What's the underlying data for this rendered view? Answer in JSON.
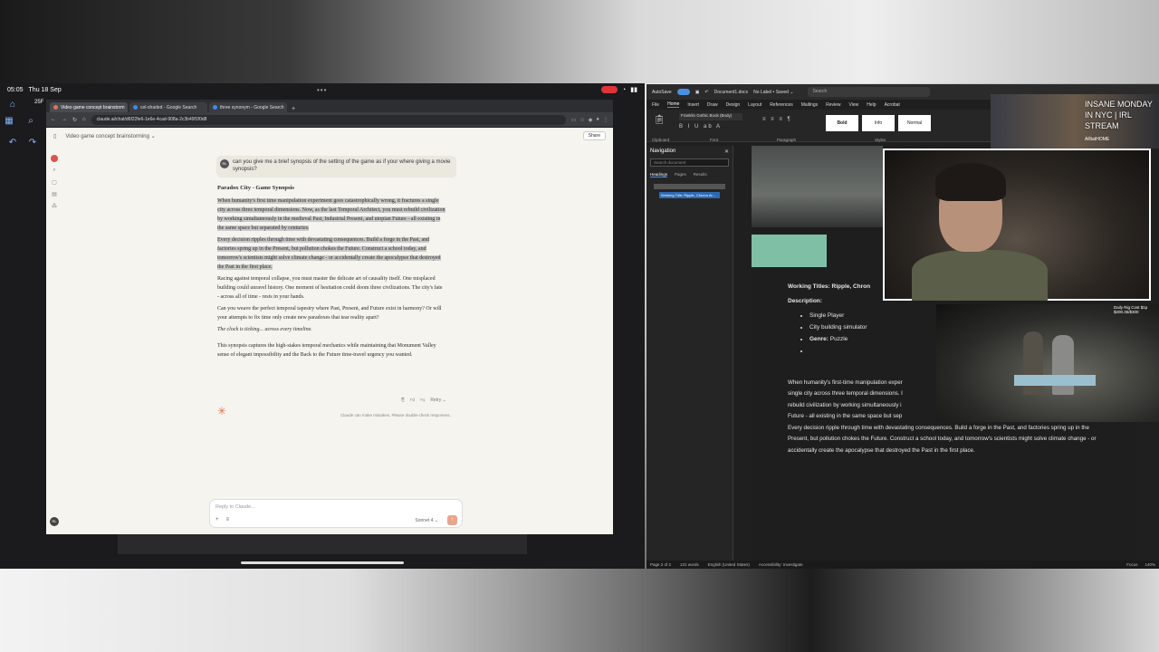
{
  "ipad": {
    "time": "05:05",
    "date": "Thu 18 Sep",
    "dots": "•••",
    "weather": "25F",
    "battery": "▮▮"
  },
  "browser": {
    "tabs": [
      {
        "label": "Video game concept brainstorm",
        "icon": "claude-icon"
      },
      {
        "label": "cel-shaded - Google Search",
        "icon": "google-icon"
      },
      {
        "label": "three synonym - Google Search",
        "icon": "google-icon"
      }
    ],
    "url": "claude.ai/chat/d6f22fe6-1e6e-4cad-908a-2c3b49f1f0d8",
    "new_tab": "+"
  },
  "claude": {
    "chat_title": "Video game concept brainstorming ⌄",
    "share_label": "Share",
    "user_initials": "RL",
    "user_message": "can you give me a brief synopsis of the setting of the game as if your where giving a movie synopsis?",
    "response_title": "Paradox City - Game Synopsis",
    "p1": "When humanity's first time manipulation experiment goes catastrophically wrong, it fractures a single city across three temporal dimensions. Now, as the last Temporal Architect, you must rebuild civilization by working simultaneously in the medieval Past, Industrial Present, and utopian Future - all existing in the same space but separated by centuries.",
    "p2": "Every decision ripples through time with devastating consequences. Build a forge in the Past, and factories spring up in the Present, but pollution chokes the Future. Construct a school today, and tomorrow's scientists might solve climate change - or accidentally create the apocalypse that destroyed the Past in the first place.",
    "p3": "Racing against temporal collapse, you must master the delicate art of causality itself. One misplaced building could unravel history. One moment of hesitation could doom three civilizations. The city's fate - across all of time - rests in your hands.",
    "p4": "Can you weave the perfect temporal tapestry where Past, Present, and Future exist in harmony? Or will your attempts to fix time only create new paradoxes that tear reality apart?",
    "p5": "The clock is ticking... across every timeline.",
    "p6": "This synopsis captures the high-stakes temporal mechanics while maintaining that Monument Valley sense of elegant impossibility and the Back to the Future time-travel urgency you wanted.",
    "retry_label": "Retry ⌄",
    "disclaimer": "Claude can make mistakes. Please double-check responses.",
    "reply_placeholder": "Reply to Claude...",
    "model_label": "Sonnet 4 ⌄",
    "send_glyph": "↑"
  },
  "word": {
    "autosave": "AutoSave",
    "doc_name": "Document1.docx",
    "label": "No Label • Saved ⌄",
    "search_placeholder": "Search",
    "menu": [
      "File",
      "Home",
      "Insert",
      "Draw",
      "Design",
      "Layout",
      "References",
      "Mailings",
      "Review",
      "View",
      "Help",
      "Acrobat"
    ],
    "font": "Franklin Gothic Book (Body)",
    "styles": [
      "Bold",
      "Info",
      "Normal"
    ],
    "group_labels": [
      "Clipboard",
      "Font",
      "Paragraph",
      "Styles"
    ],
    "nav_title": "Navigation",
    "nav_search": "Search document",
    "nav_tabs": [
      "Headings",
      "Pages",
      "Results"
    ],
    "nav_item": "Working Title: Ripple, Chrono Ar...",
    "working_titles": "Working Titles: Ripple, Chron",
    "description": "Description:",
    "bullets": [
      "Single Player",
      "City building simulator",
      "Puzzle",
      ""
    ],
    "genre_label": "Genre:",
    "para1_lines": [
      "When humanity's first-time manipulation exper",
      "single city across three temporal dimensions. I",
      "rebuild civilization by working simultaneously i",
      "Future - all existing in the same space but sep"
    ],
    "para2": "Every decision ripple through time with devastating consequences. Build a forge in the Past, and factories spring up in the Present, but pollution chokes the Future. Construct a school today, and tomorrow's scientists might solve climate change - or accidentally create the apocalypse that destroyed the Past in the first place.",
    "status": {
      "page": "Page 2 of 2",
      "words": "131 words",
      "lang": "English (United States)",
      "access": "Accessibility: Investigate",
      "focus": "Focus",
      "zoom": "140%"
    }
  },
  "stream": {
    "title": "INSANE MONDAY IN NYC | IRL STREAM",
    "subtitle": "ARiatHOME",
    "irl_corner": "Daily Rig Cost $1p",
    "irl_sub": "$200.35/$300"
  },
  "colors": {
    "accent": "#d97757",
    "word_blue": "#4b8fe2",
    "swatch": "#7fbfa6"
  }
}
